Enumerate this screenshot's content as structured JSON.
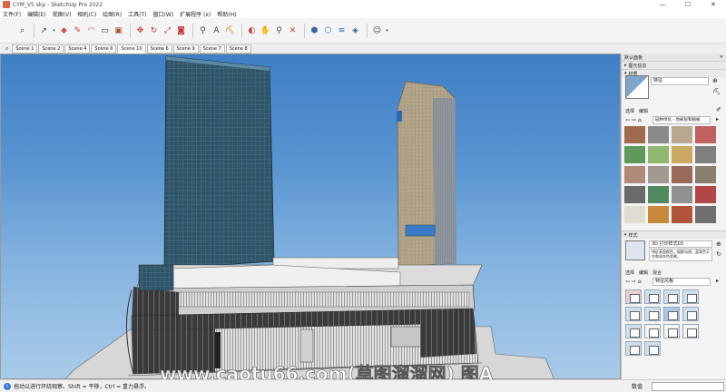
{
  "window": {
    "title": "CYM_V5.skp - SketchUp Pro 2022",
    "controls": [
      "—",
      "☐",
      "✕"
    ]
  },
  "menu": {
    "items": [
      "文件(F)",
      "编辑(E)",
      "视图(V)",
      "相机(C)",
      "绘图(R)",
      "工具(T)",
      "窗口(W)",
      "扩展程序 (x)",
      "帮助(H)"
    ]
  },
  "toolbar": {
    "tools": [
      "search-icon",
      "select-arrow-icon",
      "eraser-icon",
      "pencil-icon",
      "arc-icon",
      "shape-icon",
      "push-pull-icon",
      "move-icon",
      "rotate-icon",
      "scale-icon",
      "tape-icon",
      "text-icon",
      "paint-icon",
      "orbit-icon",
      "pan-icon",
      "zoom-icon",
      "zoom-extents-icon",
      "warehouse-icon",
      "extension-icon",
      "user-icon"
    ]
  },
  "scenes": {
    "tabs": [
      "Scene 1",
      "Scene 2",
      "Scene 4",
      "Scene 6",
      "Scene 10",
      "Scene 6",
      "Scene 9",
      "Scene 7",
      "Scene 8"
    ],
    "active_index": 4
  },
  "tray": {
    "title": "默认面板",
    "entity_info_label": "图元信息",
    "materials_label": "材质",
    "material_name": "特征",
    "select_tab": "选择",
    "edit_tab": "编辑",
    "material_library": "园林绿化 - 地被层和植被",
    "styles_label": "样式",
    "style_name": "3D 打印样式03",
    "style_desc": "特征表面颜色，粗影勾线，蓝背色天空和深灰色背景。",
    "style_select_tab": "选择",
    "style_edit_tab": "编辑",
    "style_mix_tab": "混合",
    "style_library": "特征风格"
  },
  "status": {
    "message": "拖动以进行环绕观察。Shift = 平移，Ctrl = 重力悬浮。",
    "measure_label": "数值"
  },
  "watermark": "www.caotu66.com(草图溜溜网) 图A",
  "colors": {
    "sky_top": "#3f7fc6",
    "sky_bottom": "#a9cbe9",
    "tower_glass": "#2f5468",
    "tower_beige": "#b3a58a"
  }
}
